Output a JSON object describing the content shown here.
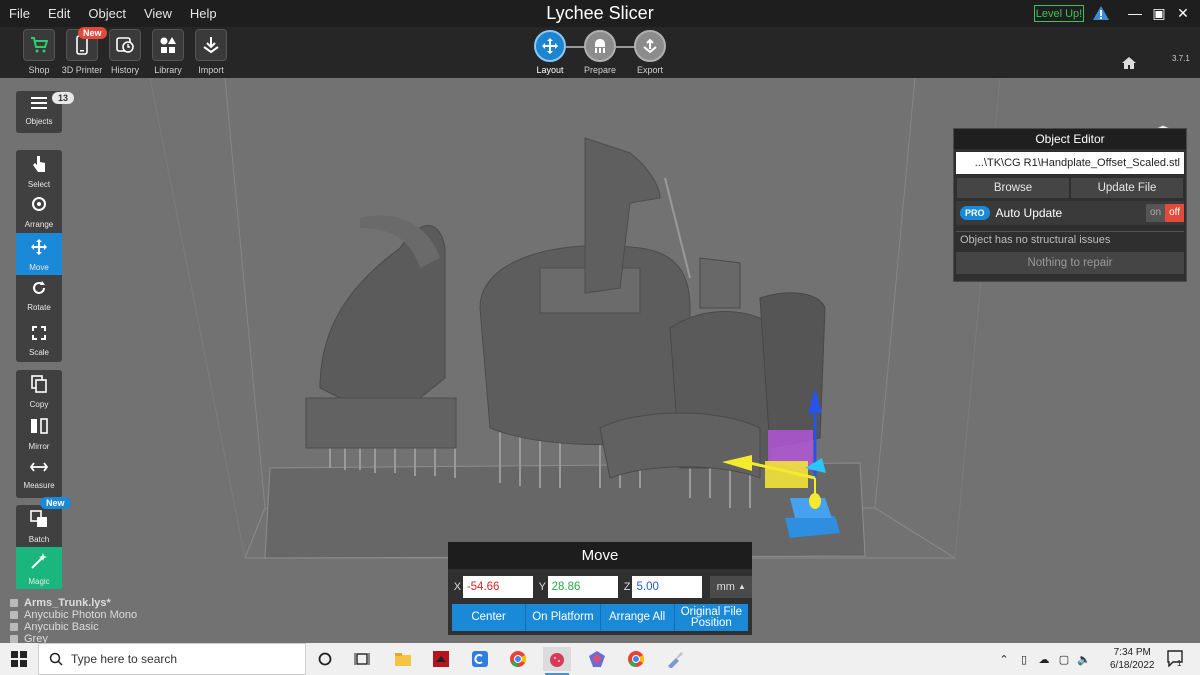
{
  "menu": [
    "File",
    "Edit",
    "Object",
    "View",
    "Help"
  ],
  "app_title": "Lychee Slicer",
  "level_up": "Level Up!",
  "version": "3.7.1",
  "toolbar": {
    "items": [
      {
        "label": "Shop",
        "icon": "cart-icon"
      },
      {
        "label": "3D Printer",
        "icon": "phone-icon"
      },
      {
        "label": "History",
        "icon": "history-icon"
      },
      {
        "label": "Library",
        "icon": "library-icon"
      },
      {
        "label": "Import",
        "icon": "import-icon"
      }
    ],
    "new_badge": "New"
  },
  "workflow": {
    "steps": [
      {
        "label": "Layout",
        "icon": "layout-icon"
      },
      {
        "label": "Prepare",
        "icon": "prepare-icon"
      },
      {
        "label": "Export",
        "icon": "export-icon"
      }
    ],
    "active": "Layout"
  },
  "left_tools": {
    "objects_label": "Objects",
    "objects_count": "13",
    "tools": [
      "Select",
      "Arrange",
      "Move",
      "Rotate",
      "Scale"
    ],
    "edit_tools": [
      "Copy",
      "Mirror",
      "Measure"
    ],
    "batch_label": "Batch",
    "batch_badge": "New",
    "magic_label": "Magic",
    "active": "Move"
  },
  "object_editor": {
    "title": "Object Editor",
    "path": "...\\TK\\CG R1\\Handplate_Offset_Scaled.stl",
    "browse": "Browse",
    "update_file": "Update File",
    "pro": "PRO",
    "auto_update": "Auto Update",
    "toggle_on": "on",
    "toggle_off": "off",
    "status": "Object has no structural issues",
    "repair": "Nothing to repair"
  },
  "move_panel": {
    "title": "Move",
    "x_label": "X",
    "x_value": "-54.66",
    "y_label": "Y",
    "y_value": "28.86",
    "z_label": "Z",
    "z_value": "5.00",
    "unit": "mm",
    "buttons": [
      "Center",
      "On Platform",
      "Arrange All",
      "Original File Position"
    ]
  },
  "file_info": {
    "file": "Arms_Trunk.lys*",
    "printer": "Anycubic Photon Mono",
    "resin": "Anycubic Basic",
    "color": "Grey"
  },
  "taskbar": {
    "search_placeholder": "Type here to search",
    "time": "7:34 PM",
    "date": "6/18/2022",
    "notifications": "1"
  },
  "colors": {
    "accent": "#1a8ad8",
    "magic": "#1bb57e",
    "level_up": "#3ec25b",
    "x_value": "#d62828",
    "y_value": "#2aa84a",
    "z_value": "#1f5fd6"
  }
}
